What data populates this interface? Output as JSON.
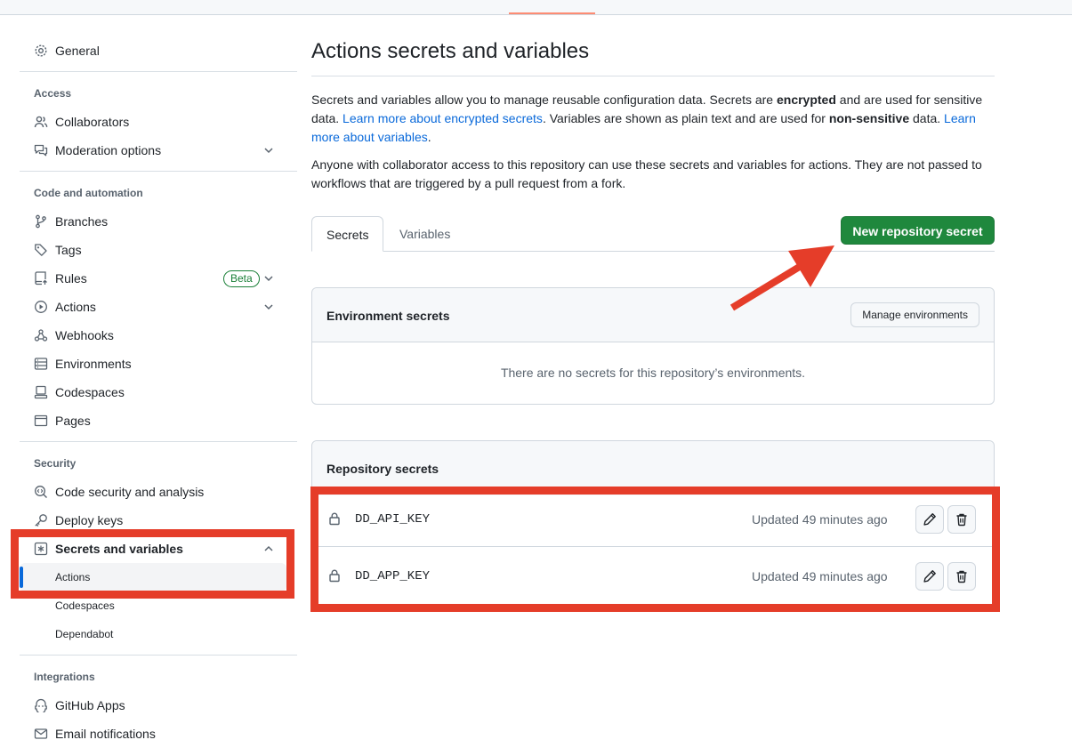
{
  "sidebar": {
    "general": "General",
    "access_heading": "Access",
    "access_items": [
      {
        "label": "Collaborators",
        "icon": "people-icon"
      },
      {
        "label": "Moderation options",
        "icon": "comment-discussion-icon"
      }
    ],
    "code_heading": "Code and automation",
    "code_items": [
      {
        "label": "Branches",
        "icon": "git-branch-icon"
      },
      {
        "label": "Tags",
        "icon": "tag-icon"
      },
      {
        "label": "Rules",
        "icon": "repo-push-icon",
        "badge": "Beta"
      },
      {
        "label": "Actions",
        "icon": "play-icon"
      },
      {
        "label": "Webhooks",
        "icon": "webhook-icon"
      },
      {
        "label": "Environments",
        "icon": "server-icon"
      },
      {
        "label": "Codespaces",
        "icon": "codespaces-icon"
      },
      {
        "label": "Pages",
        "icon": "browser-icon"
      }
    ],
    "security_heading": "Security",
    "security_items": [
      {
        "label": "Code security and analysis",
        "icon": "codescan-icon"
      },
      {
        "label": "Deploy keys",
        "icon": "key-icon"
      },
      {
        "label": "Secrets and variables",
        "icon": "key-asterisk-icon"
      }
    ],
    "secrets_sub": [
      "Actions",
      "Codespaces",
      "Dependabot"
    ],
    "integrations_heading": "Integrations",
    "integrations_items": [
      {
        "label": "GitHub Apps",
        "icon": "apps-icon"
      },
      {
        "label": "Email notifications",
        "icon": "mail-icon"
      }
    ]
  },
  "main": {
    "title": "Actions secrets and variables",
    "intro": {
      "t1": "Secrets and variables allow you to manage reusable configuration data. Secrets are ",
      "b1": "encrypted",
      "t2": " and are used for sensitive data. ",
      "link1": "Learn more about encrypted secrets",
      "t3": ". Variables are shown as plain text and are used for ",
      "b2": "non-sensitive",
      "t4": " data. ",
      "link2": "Learn more about variables",
      "t5": "."
    },
    "note": "Anyone with collaborator access to this repository can use these secrets and variables for actions. They are not passed to workflows that are triggered by a pull request from a fork.",
    "tabs": [
      "Secrets",
      "Variables"
    ],
    "new_secret_button": "New repository secret",
    "env_secrets": {
      "title": "Environment secrets",
      "manage_button": "Manage environments",
      "empty": "There are no secrets for this repository’s environments."
    },
    "repo_secrets": {
      "title": "Repository secrets",
      "rows": [
        {
          "name": "DD_API_KEY",
          "updated": "Updated 49 minutes ago"
        },
        {
          "name": "DD_APP_KEY",
          "updated": "Updated 49 minutes ago"
        }
      ]
    }
  },
  "colors": {
    "primary_button": "#1f883d",
    "link": "#0969da",
    "annotation": "#e53d29",
    "selected_indicator": "#0969da"
  }
}
